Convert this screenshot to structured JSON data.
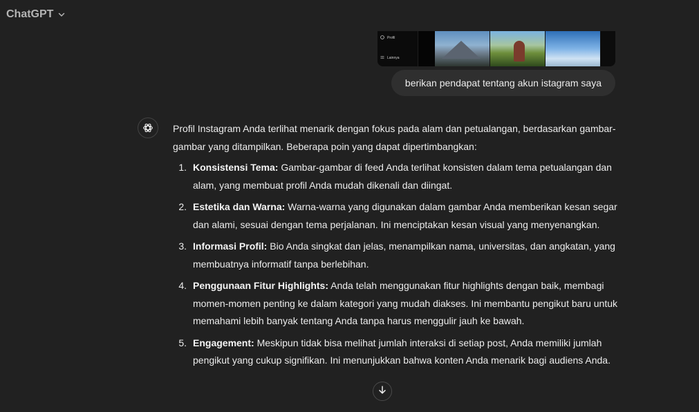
{
  "header": {
    "model_name": "ChatGPT"
  },
  "user_message": {
    "image_sidebar": {
      "item1": "Profil",
      "item2": "Lainnya"
    },
    "text": "berikan pendapat tentang akun istagram saya"
  },
  "assistant_message": {
    "intro": "Profil Instagram Anda terlihat menarik dengan fokus pada alam dan petualangan, berdasarkan gambar-gambar yang ditampilkan. Beberapa poin yang dapat dipertimbangkan:",
    "points": [
      {
        "number": "1.",
        "title": "Konsistensi Tema:",
        "text": " Gambar-gambar di feed Anda terlihat konsisten dalam tema petualangan dan alam, yang membuat profil Anda mudah dikenali dan diingat."
      },
      {
        "number": "2.",
        "title": "Estetika dan Warna:",
        "text": " Warna-warna yang digunakan dalam gambar Anda memberikan kesan segar dan alami, sesuai dengan tema perjalanan. Ini menciptakan kesan visual yang menyenangkan."
      },
      {
        "number": "3.",
        "title": "Informasi Profil:",
        "text": " Bio Anda singkat dan jelas, menampilkan nama, universitas, dan angkatan, yang membuatnya informatif tanpa berlebihan."
      },
      {
        "number": "4.",
        "title": "Penggunaan Fitur Highlights:",
        "text": " Anda telah menggunakan fitur highlights dengan baik, membagi momen-momen penting ke dalam kategori yang mudah diakses. Ini membantu pengikut baru untuk memahami lebih banyak tentang Anda tanpa harus menggulir jauh ke bawah."
      },
      {
        "number": "5.",
        "title": "Engagement:",
        "text": " Meskipun tidak bisa melihat jumlah interaksi di setiap post, Anda memiliki jumlah pengikut yang cukup signifikan. Ini menunjukkan bahwa konten Anda menarik bagi audiens Anda."
      }
    ]
  },
  "icons": {
    "model_dropdown": "chevron-down-icon",
    "assistant_avatar": "openai-logo-icon",
    "scroll": "arrow-down-icon"
  },
  "colors": {
    "background": "#212121",
    "user_bubble": "#2f2f2f",
    "text": "#ececec",
    "muted_text": "#b4b4b4"
  }
}
